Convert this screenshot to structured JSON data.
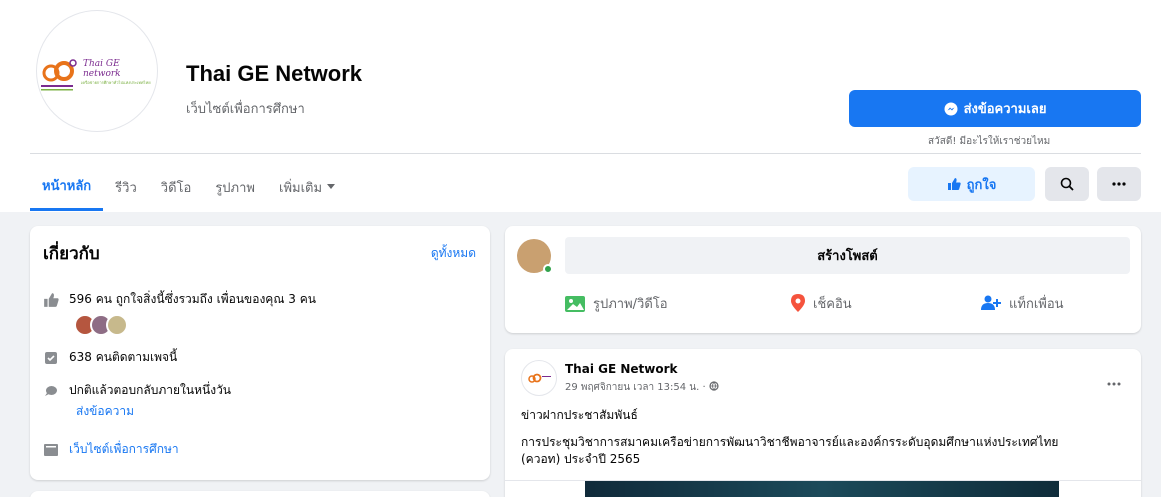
{
  "page": {
    "name": "Thai GE Network",
    "category": "เว็บไซต์เพื่อการศึกษา",
    "logo_text": "Thai GE network",
    "logo_sub": "เครือข่ายการศึกษาทั่วไปแห่งประเทศไทย"
  },
  "actions": {
    "message_label": "ส่งข้อความเลย",
    "message_hint": "สวัสดี! มีอะไรให้เราช่วยไหม",
    "like_label": "ถูกใจ"
  },
  "tabs": [
    {
      "label": "หน้าหลัก",
      "active": true
    },
    {
      "label": "รีวิว",
      "active": false
    },
    {
      "label": "วิดีโอ",
      "active": false
    },
    {
      "label": "รูปภาพ",
      "active": false
    },
    {
      "label": "เพิ่มเติม",
      "active": false
    }
  ],
  "about": {
    "title": "เกี่ยวกับ",
    "see_all": "ดูทั้งหมด",
    "likes": "596 คน ถูกใจสิ่งนี้ซึ่งรวมถึง เพื่อนของคุณ 3 คน",
    "followers": "638 คนติดตามเพจนี้",
    "response": "ปกติแล้วตอบกลับภายในหนึ่งวัน",
    "send_message": "ส่งข้อความ",
    "website": "เว็บไซต์เพื่อการศึกษา"
  },
  "composer": {
    "create_post": "สร้างโพสต์",
    "photo_video": "รูปภาพ/วิดีโอ",
    "check_in": "เช็คอิน",
    "tag_friends": "แท็กเพื่อน"
  },
  "post": {
    "author": "Thai GE Network",
    "time": "29 พฤศจิกายน เวลา 13:54 น. ·",
    "line1": "ข่าวฝากประชาสัมพันธ์",
    "line2": "การประชุมวิชาการสมาคมเครือข่ายการพัฒนาวิชาชีพอาจารย์และองค์กรระดับอุดมศึกษาแห่งประเทศไทย",
    "line3": "(ควอท) ประจำปี 2565"
  },
  "colors": {
    "accent": "#1877f2",
    "background": "#f0f2f5"
  }
}
